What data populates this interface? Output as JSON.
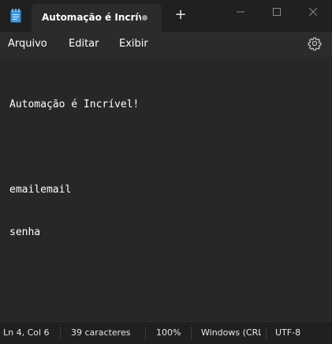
{
  "tab": {
    "title": "Automação é Incríve",
    "unsaved_indicator": "dot-icon",
    "new_tab_label": "+"
  },
  "window_controls": [
    "minimize-icon",
    "maximize-icon",
    "close-icon"
  ],
  "menu": {
    "items": [
      "Arquivo",
      "Editar",
      "Exibir"
    ],
    "settings_icon": "gear-icon"
  },
  "editor": {
    "lines": [
      "Automação é Incrível!",
      "",
      "emailemail",
      "senha"
    ]
  },
  "status": {
    "position": "Ln 4, Col 6",
    "char_count": "39 caracteres",
    "zoom": "100%",
    "line_ending": "Windows (CRL",
    "encoding": "UTF-8"
  },
  "colors": {
    "titlebar_bg": "#202020",
    "tab_bg": "#2b2b2b",
    "editor_bg": "#272727",
    "notepad_icon": "#3a96dd"
  }
}
